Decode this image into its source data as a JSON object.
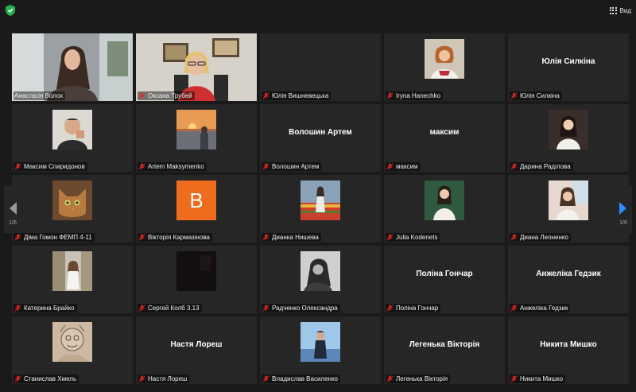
{
  "topbar": {
    "view_label": "Вид"
  },
  "pager": {
    "left": "1/6",
    "right": "1/6"
  },
  "accent": "#c7e06a",
  "participants": [
    {
      "name": "Анастасія Волох",
      "kind": "video1",
      "muted": false,
      "active": true
    },
    {
      "name": "Оксана Трубей",
      "kind": "video2",
      "muted": true
    },
    {
      "name": "Юлія Вишневецька",
      "kind": "blank",
      "muted": true
    },
    {
      "name": "Iryna Hanechko",
      "kind": "photo",
      "scene": "iryna",
      "muted": true
    },
    {
      "name": "Юлія Силкіна",
      "kind": "text",
      "muted": true
    },
    {
      "name": "Максим Спиридонов",
      "kind": "photo",
      "scene": "maxim",
      "muted": true
    },
    {
      "name": "Artem Maksymenko",
      "kind": "photo",
      "scene": "sunset",
      "muted": true
    },
    {
      "name": "Волошин Артем",
      "kind": "text",
      "muted": true
    },
    {
      "name": "максим",
      "kind": "text",
      "muted": true
    },
    {
      "name": "Дарина Раділова",
      "kind": "photo",
      "scene": "daryna",
      "muted": true
    },
    {
      "name": "Діма Гомон ФЕМП 4-11",
      "kind": "photo",
      "scene": "cat",
      "muted": true
    },
    {
      "name": "Вікторія Кармазінова",
      "kind": "letter",
      "letter": "B",
      "muted": true
    },
    {
      "name": "Дианка Нишева",
      "kind": "photo",
      "scene": "tulips",
      "muted": true
    },
    {
      "name": "Julia Kodenets",
      "kind": "photo",
      "scene": "julia",
      "muted": true
    },
    {
      "name": "Диана Леоненко",
      "kind": "photo",
      "scene": "diana",
      "muted": true
    },
    {
      "name": "Катерина Брайко",
      "kind": "photo",
      "scene": "kateryna",
      "muted": true
    },
    {
      "name": "Сергей Колб 3.13",
      "kind": "photo",
      "scene": "dark",
      "muted": true
    },
    {
      "name": "Радченко Олександра",
      "kind": "photo",
      "scene": "bw",
      "muted": true
    },
    {
      "name": "Поліна Гончар",
      "kind": "text",
      "muted": true
    },
    {
      "name": "Анжеліка Гедзик",
      "kind": "text",
      "muted": true
    },
    {
      "name": "Станислав Хмель",
      "kind": "photo",
      "scene": "sketch",
      "muted": true
    },
    {
      "name": "Настя Лореш",
      "kind": "text",
      "muted": true
    },
    {
      "name": "Владислав Василенко",
      "kind": "photo",
      "scene": "vlad",
      "muted": true
    },
    {
      "name": "Легенька Вікторія",
      "kind": "text",
      "muted": true
    },
    {
      "name": "Никита Мишко",
      "kind": "text",
      "muted": true
    }
  ]
}
